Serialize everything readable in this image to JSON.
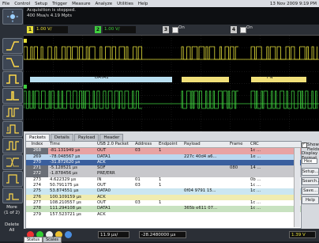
{
  "menu": {
    "items": [
      "File",
      "Control",
      "Setup",
      "Trigger",
      "Measure",
      "Analyze",
      "Utilities",
      "Help"
    ],
    "datetime": "13 Nov 2009  9:19 PM"
  },
  "status": {
    "line1": "Acquisition is stopped.",
    "line2": "400 Msa/s    4.19 Mpts"
  },
  "channels": [
    {
      "num": "1",
      "value": "1.00 V/",
      "color": "#e6e03a",
      "check_label": "On"
    },
    {
      "num": "2",
      "value": "1.00 V/",
      "color": "#3fcf3f",
      "check_label": "On"
    },
    {
      "num": "3",
      "check_label": "On"
    },
    {
      "num": "4",
      "check_label": "On"
    }
  ],
  "left_toolbar": {
    "more_label": "More",
    "more_sub": "(1 of 2)",
    "delete_label": "Delete",
    "delete_sub": "All"
  },
  "screen": {
    "data1_label": "DATA1",
    "in_label": "I N"
  },
  "packets_panel": {
    "tabs": [
      "Packets",
      "Details",
      "Payload",
      "Header"
    ],
    "columns": [
      "Index",
      "Time",
      "USB 2.0 Packet",
      "Address",
      "Endpoint",
      "Payload",
      "Frame",
      "CRC"
    ],
    "rows": [
      {
        "style": "red",
        "index": "268",
        "time": "-81.131949 µs",
        "packet": "OUT",
        "address": "03",
        "endpoint": "1",
        "payload": "",
        "frame": "",
        "crc": "1c ..."
      },
      {
        "style": "lblue",
        "index": "269",
        "time": "-78.048567 µs",
        "packet": "DATA1",
        "address": "",
        "endpoint": "",
        "payload": "227c 40d4 a6...",
        "frame": "",
        "crc": "1e ..."
      },
      {
        "style": "sel",
        "index": "270",
        "time": "-31.872620 µs",
        "packet": "ACK",
        "address": "",
        "endpoint": "",
        "payload": "",
        "frame": "",
        "crc": ""
      },
      {
        "style": "gray",
        "index": "271",
        "time": "-5.128521 µs",
        "packet": "SOF",
        "address": "",
        "endpoint": "",
        "payload": "",
        "frame": "080",
        "crc": "14 ..."
      },
      {
        "style": "gray",
        "index": "272",
        "time": "-1.878456 µs",
        "packet": "PRE/ERR",
        "address": "",
        "endpoint": "",
        "payload": "",
        "frame": "",
        "crc": ""
      },
      {
        "style": "white",
        "index": "273",
        "time": "4.622329 µs",
        "packet": "IN",
        "address": "01",
        "endpoint": "1",
        "payload": "",
        "frame": "",
        "crc": "0b ..."
      },
      {
        "style": "white",
        "index": "274",
        "time": "50.791175 µs",
        "packet": "OUT",
        "address": "03",
        "endpoint": "1",
        "payload": "",
        "frame": "",
        "crc": "1c ..."
      },
      {
        "style": "cyan",
        "index": "275",
        "time": "53.874551 µs",
        "packet": "DATA0",
        "address": "",
        "endpoint": "",
        "payload": "0f04 9791 15...",
        "frame": "",
        "crc": "1c ..."
      },
      {
        "style": "yel",
        "index": "276",
        "time": "100.109159 µs",
        "packet": "ACK",
        "address": "",
        "endpoint": "",
        "payload": "",
        "frame": "",
        "crc": ""
      },
      {
        "style": "white",
        "index": "277",
        "time": "108.210557 µs",
        "packet": "OUT",
        "address": "03",
        "endpoint": "1",
        "payload": "",
        "frame": "",
        "crc": "1c ..."
      },
      {
        "style": "grn",
        "index": "278",
        "time": "111.294108 µs",
        "packet": "DATA1",
        "address": "",
        "endpoint": "",
        "payload": "365b e611 07...",
        "frame": "",
        "crc": "1c ..."
      },
      {
        "style": "white",
        "index": "279",
        "time": "157.523721 µs",
        "packet": "ACK",
        "address": "",
        "endpoint": "",
        "payload": "",
        "frame": "",
        "crc": ""
      }
    ],
    "show_fields_label": "Show Fields",
    "display_format_label": "Display Format",
    "display_format_value": "Hex",
    "buttons": [
      "Setup...",
      "Search...",
      "Save...",
      "Help"
    ]
  },
  "bottom": {
    "time_div": "11.9 µs/",
    "delay": "-28.2480000 µs",
    "ch_value": "1.39 V"
  },
  "status_tabs": [
    "Status",
    "Scales"
  ]
}
